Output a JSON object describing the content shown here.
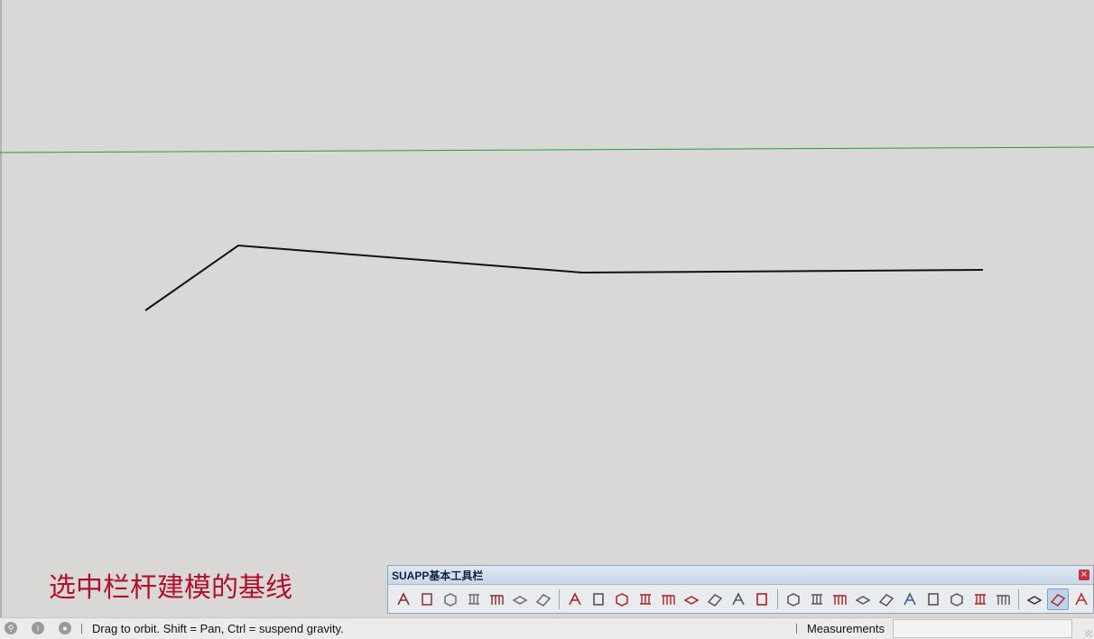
{
  "caption": "选中栏杆建模的基线",
  "toolbar": {
    "title": "SUAPP基本工具栏",
    "close_glyph": "×",
    "groups": [
      [
        {
          "icon": "stair-icon",
          "color": "#8b2a2a"
        },
        {
          "icon": "column-icon",
          "color": "#9a3a3a"
        },
        {
          "icon": "box-frame-icon",
          "color": "#6a6a6a"
        },
        {
          "icon": "wall-grid-icon",
          "color": "#6a6a6a"
        },
        {
          "icon": "railing-icon",
          "color": "#8b2a2a"
        },
        {
          "icon": "slab-icon",
          "color": "#6a6a6a"
        },
        {
          "icon": "roof-slab-icon",
          "color": "#6a6a6a"
        }
      ],
      [
        {
          "icon": "line-tool-icon",
          "color": "#b02020"
        },
        {
          "icon": "arc-tool-icon",
          "color": "#555555"
        },
        {
          "icon": "curve-check-icon",
          "color": "#b02020"
        },
        {
          "icon": "roof-icon",
          "color": "#b02020"
        },
        {
          "icon": "plane-icon",
          "color": "#b02020"
        },
        {
          "icon": "extrude-icon",
          "color": "#b02020"
        },
        {
          "icon": "chain-icon",
          "color": "#555555"
        },
        {
          "icon": "angle-icon",
          "color": "#555555"
        },
        {
          "icon": "offset-icon",
          "color": "#b02020"
        }
      ],
      [
        {
          "icon": "cube-icon",
          "color": "#555555"
        },
        {
          "icon": "split-icon",
          "color": "#555555"
        },
        {
          "icon": "pyramid-icon",
          "color": "#b02020"
        },
        {
          "icon": "bend-icon",
          "color": "#555555"
        },
        {
          "icon": "soften-icon",
          "color": "#555555"
        },
        {
          "icon": "layers-icon",
          "color": "#3a5a9a"
        },
        {
          "icon": "scale-icon",
          "color": "#555555"
        },
        {
          "icon": "frame-icon",
          "color": "#555555"
        },
        {
          "icon": "pin-icon",
          "color": "#b02020"
        },
        {
          "icon": "pen-icon",
          "color": "#555555"
        }
      ],
      [
        {
          "icon": "model-b-icon",
          "color": "#333333"
        },
        {
          "icon": "suapp-logo-icon",
          "color": "#c0282f",
          "active": true
        },
        {
          "icon": "su-app-icon",
          "color": "#c0282f"
        }
      ]
    ]
  },
  "status": {
    "icons": [
      "geo-location-icon",
      "info-icon",
      "user-icon"
    ],
    "message": "Drag to orbit. Shift = Pan, Ctrl = suspend gravity.",
    "measurements_label": "Measurements",
    "measurements_value": ""
  },
  "colors": {
    "background": "#d9d8d6",
    "green_axis": "#2a9b2a",
    "baseline": "#111111",
    "caption": "#b0102a"
  }
}
